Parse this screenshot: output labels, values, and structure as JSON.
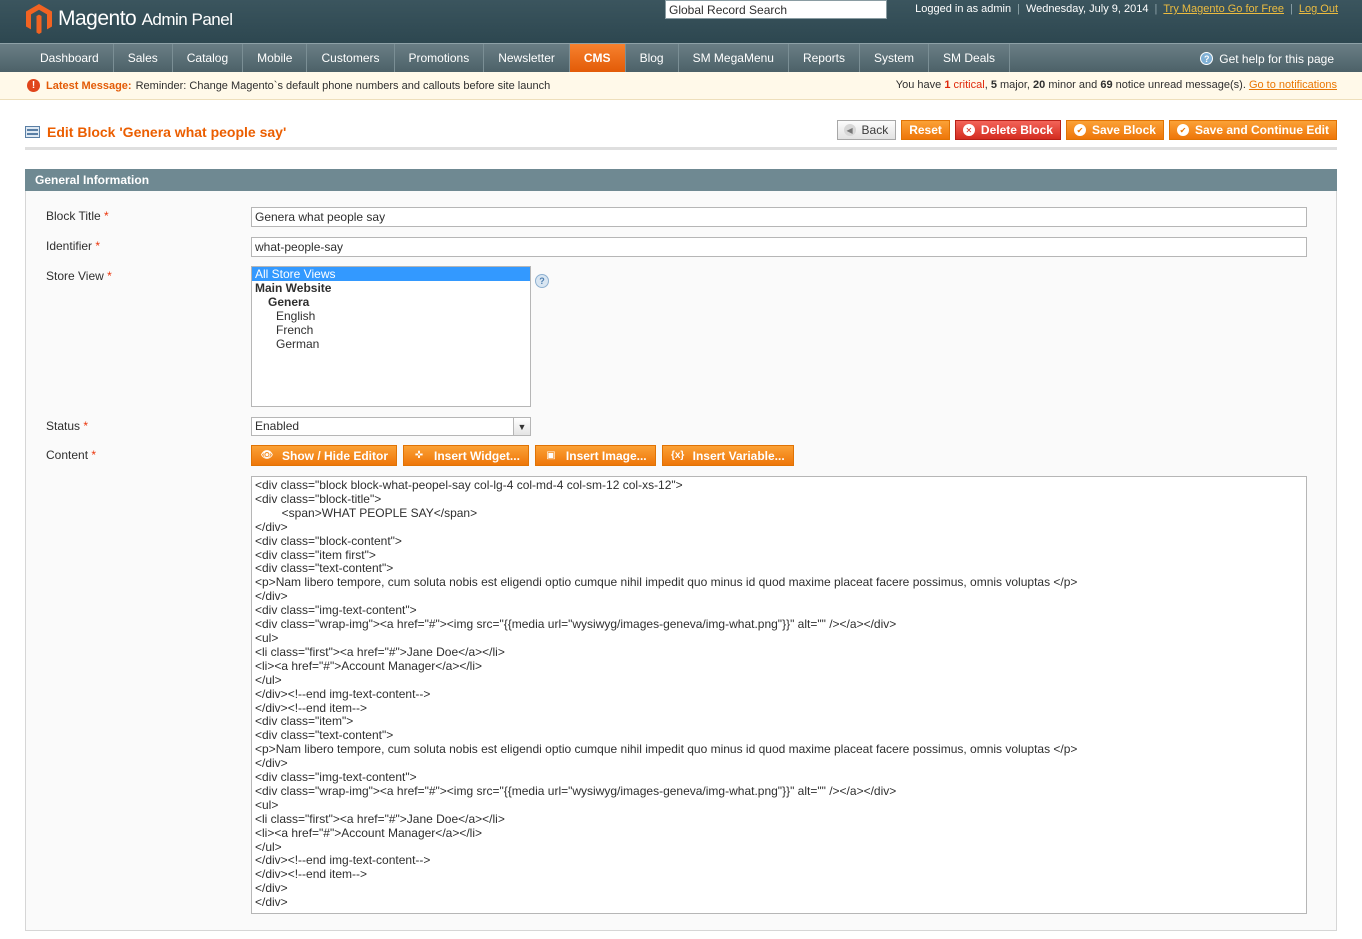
{
  "header": {
    "logo_brand": "Magento",
    "logo_sub": "Admin Panel",
    "search_value": "Global Record Search",
    "logged_in": "Logged in as admin",
    "date": "Wednesday, July 9, 2014",
    "try_link": "Try Magento Go for Free",
    "logout": "Log Out"
  },
  "nav": {
    "items": [
      "Dashboard",
      "Sales",
      "Catalog",
      "Mobile",
      "Customers",
      "Promotions",
      "Newsletter",
      "CMS",
      "Blog",
      "SM MegaMenu",
      "Reports",
      "System",
      "SM Deals"
    ],
    "active": "CMS",
    "help_text": "Get help for this page"
  },
  "message": {
    "label": "Latest Message:",
    "text": "Reminder: Change Magento`s default phone numbers and callouts before site launch",
    "right_prefix": "You have",
    "critical_count": "1",
    "critical_word": "critical",
    "major_count": "5",
    "major_word": "major,",
    "minor_count": "20",
    "minor_word": "minor and",
    "notice_count": "69",
    "notice_word": "notice unread message(s).",
    "notifications_link": "Go to notifications"
  },
  "page": {
    "title": "Edit Block 'Genera what people say'",
    "buttons": {
      "back": "Back",
      "reset": "Reset",
      "delete": "Delete Block",
      "save": "Save Block",
      "save_continue": "Save and Continue Edit"
    }
  },
  "form": {
    "section_title": "General Information",
    "required_mark": "*",
    "block_title_label": "Block Title",
    "block_title_value": "Genera what people say",
    "identifier_label": "Identifier",
    "identifier_value": "what-people-say",
    "store_view_label": "Store View",
    "store_views": {
      "all": "All Store Views",
      "website": "Main Website",
      "store": "Genera",
      "english": "English",
      "french": "French",
      "german": "German"
    },
    "status_label": "Status",
    "status_value": "Enabled",
    "content_label": "Content",
    "editor_buttons": {
      "show_hide": "Show / Hide Editor",
      "widget": "Insert Widget...",
      "image": "Insert Image...",
      "variable": "Insert Variable..."
    },
    "content_lines": [
      "<div class=\"block block-what-peopel-say col-lg-4 col-md-4 col-sm-12 col-xs-12\">",
      "<div class=\"block-title\">",
      "        <span>WHAT PEOPLE SAY</span>",
      "</div>",
      "<div class=\"block-content\">",
      "<div class=\"item first\">",
      "<div class=\"text-content\">",
      "<p>Nam libero tempore, cum soluta nobis est eligendi optio cumque nihil impedit quo minus id quod maxime placeat facere possimus, omnis voluptas </p>",
      "</div>",
      "<div class=\"img-text-content\">",
      "<div class=\"wrap-img\"><a href=\"#\"><img src=\"{{media url=\"wysiwyg/images-geneva/img-what.png\"}}\" alt=\"\" /></a></div>",
      "<ul>",
      "<li class=\"first\"><a href=\"#\">Jane Doe</a></li>",
      "<li><a href=\"#\">Account Manager</a></li>",
      "</ul>",
      "</div><!--end img-text-content-->",
      "</div><!--end item-->",
      "<div class=\"item\">",
      "<div class=\"text-content\">",
      "<p>Nam libero tempore, cum soluta nobis est eligendi optio cumque nihil impedit quo minus id quod maxime placeat facere possimus, omnis voluptas </p>",
      "</div>",
      "<div class=\"img-text-content\">",
      "<div class=\"wrap-img\"><a href=\"#\"><img src=\"{{media url=\"wysiwyg/images-geneva/img-what.png\"}}\" alt=\"\" /></a></div>",
      "<ul>",
      "<li class=\"first\"><a href=\"#\">Jane Doe</a></li>",
      "<li><a href=\"#\">Account Manager</a></li>",
      "</ul>",
      "</div><!--end img-text-content-->",
      "</div><!--end item-->",
      "</div>",
      "</div>"
    ]
  },
  "colors": {
    "accent": "#eb5e00",
    "header_bg": "#2d4750",
    "section_bg": "#6f8992"
  }
}
